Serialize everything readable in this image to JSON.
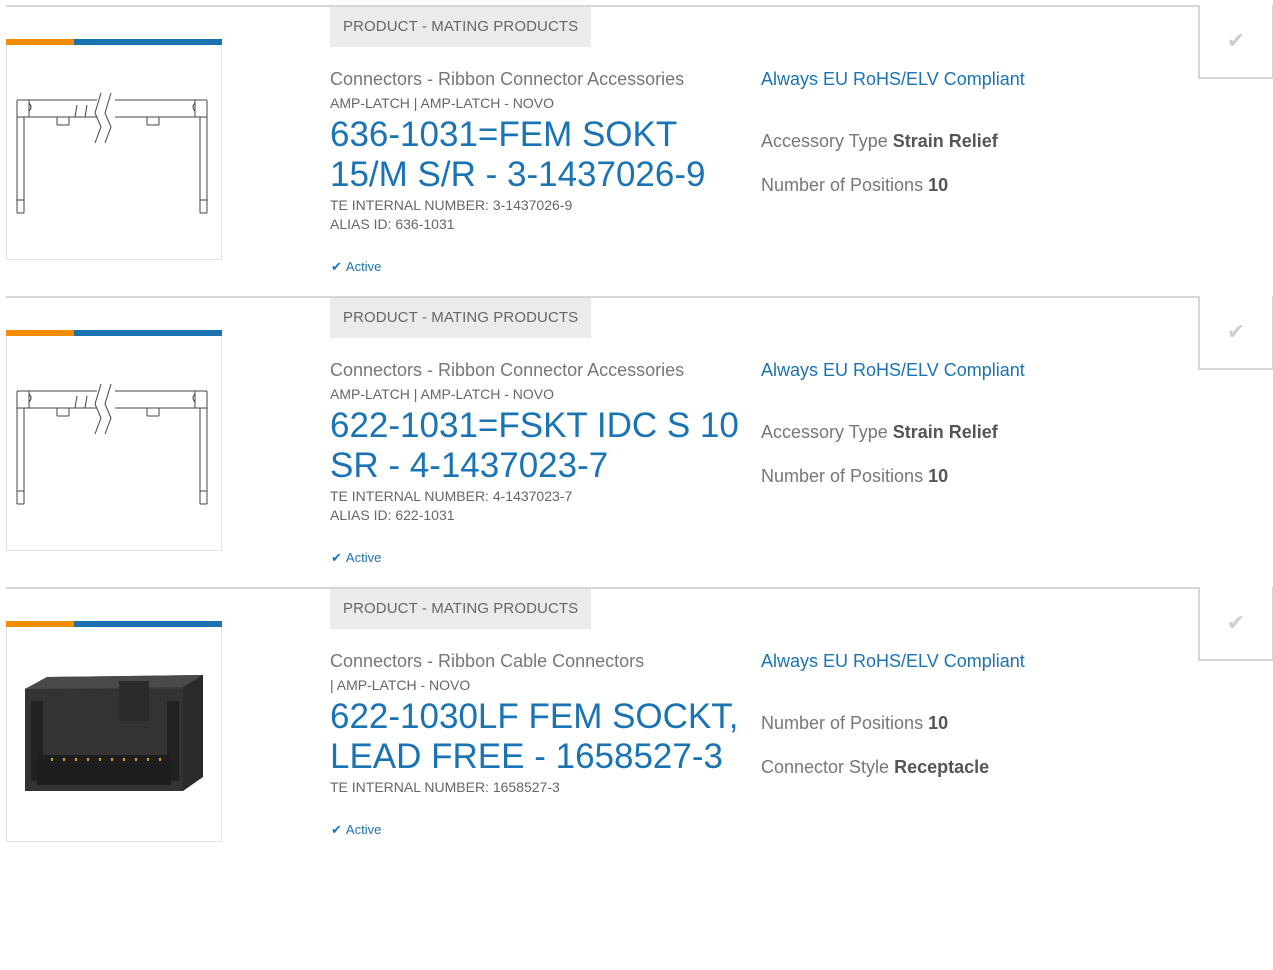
{
  "results": [
    {
      "tag": "PRODUCT - MATING PRODUCTS",
      "image": "strain-relief-drawing",
      "category": "Connectors - Ribbon Connector Accessories",
      "brand": "AMP-LATCH | AMP-LATCH - NOVO",
      "title": "636-1031=FEM SOKT 15/M S/R - 3-1437026-9",
      "internal_number": "TE INTERNAL NUMBER: 3-1437026-9",
      "alias": "ALIAS ID: 636-1031",
      "status": "Active",
      "compliance": "Always EU RoHS/ELV Compliant",
      "attributes": [
        {
          "label": "Accessory Type",
          "value": "Strain Relief"
        },
        {
          "label": "Number of Positions",
          "value": "10"
        }
      ]
    },
    {
      "tag": "PRODUCT - MATING PRODUCTS",
      "image": "strain-relief-drawing",
      "category": "Connectors - Ribbon Connector Accessories",
      "brand": "AMP-LATCH | AMP-LATCH - NOVO",
      "title": "622-1031=FSKT IDC S 10 SR - 4-1437023-7",
      "internal_number": "TE INTERNAL NUMBER: 4-1437023-7",
      "alias": "ALIAS ID: 622-1031",
      "status": "Active",
      "compliance": "Always EU RoHS/ELV Compliant",
      "attributes": [
        {
          "label": "Accessory Type",
          "value": "Strain Relief"
        },
        {
          "label": "Number of Positions",
          "value": "10"
        }
      ]
    },
    {
      "tag": "PRODUCT - MATING PRODUCTS",
      "image": "ribbon-cable-connector-photo",
      "category": "Connectors - Ribbon Cable Connectors",
      "brand": "| AMP-LATCH - NOVO",
      "title": "622-1030LF FEM SOCKT, LEAD FREE - 1658527-3",
      "internal_number": "TE INTERNAL NUMBER: 1658527-3",
      "status": "Active",
      "compliance": "Always EU RoHS/ELV Compliant",
      "attributes": [
        {
          "label": "Number of Positions",
          "value": "10"
        },
        {
          "label": "Connector Style",
          "value": "Receptacle"
        }
      ]
    }
  ],
  "colors": {
    "accent_blue": "#1a73b3",
    "accent_orange": "#f28c00",
    "tag_bg": "#ebebeb"
  },
  "icons": {
    "compare_checkbox": "check-icon",
    "status": "check-icon"
  }
}
